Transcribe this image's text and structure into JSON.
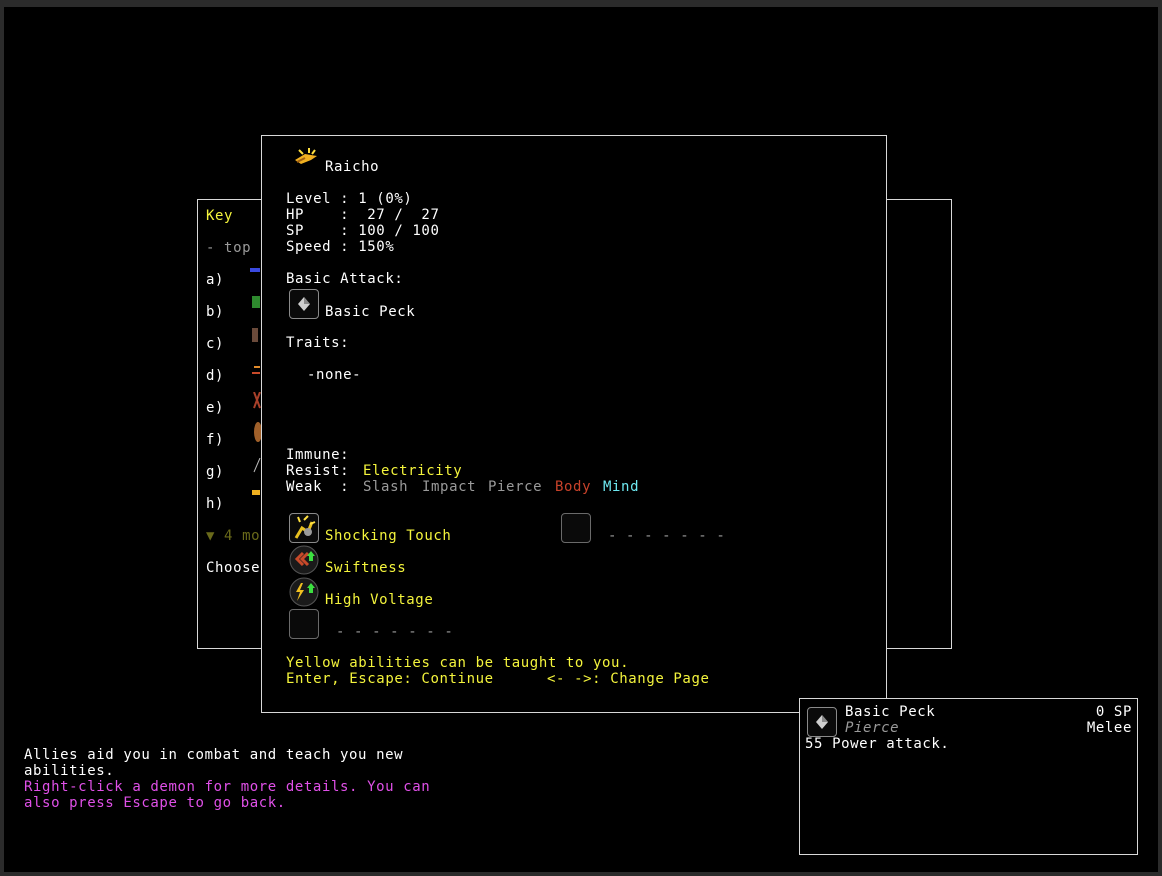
{
  "back_panel": {
    "title": "Key",
    "top_line": "- top",
    "rows": [
      "a)",
      "b)",
      "c)",
      "d)",
      "e)",
      "f)",
      "g)",
      "h)"
    ],
    "more_line": "▼ 4 mo",
    "choose_line": "Choose"
  },
  "demon": {
    "name": "Raicho",
    "stats": [
      "Level : 1 (0%)",
      "HP    :  27 /  27",
      "SP    : 100 / 100",
      "Speed : 150%"
    ],
    "basic_attack_label": "Basic Attack:",
    "basic_attack": "Basic Peck",
    "traits_label": "Traits:",
    "traits_value": "-none-",
    "immune_label": "Immune:",
    "resist_label": "Resist:",
    "resist_values": [
      "Electricity"
    ],
    "weak_label": "Weak  :",
    "weak_values": [
      "Slash",
      "Impact",
      "Pierce",
      "Body",
      "Mind"
    ],
    "abilities": [
      "Shocking Touch",
      "Swiftness",
      "High Voltage"
    ],
    "empty_slot": "- - - - - - -",
    "hint_yellow": "Yellow",
    "hint_rest": " abilities can be taught to you.",
    "controls_1": "Enter, Escape: Continue",
    "controls_2": "<- ->: Change Page"
  },
  "message_log": {
    "line1": "Allies aid you in combat and teach you new",
    "line2": "abilities.",
    "line3": "Right-click a demon for more details. You can",
    "line4": "also press Escape to go back."
  },
  "tooltip": {
    "name": "Basic Peck",
    "cost": "0 SP",
    "type": "Pierce",
    "range": "Melee",
    "description": "55 Power attack."
  },
  "colors": {
    "yellow": "#f4f43c",
    "red": "#c8422a",
    "cyan": "#6ee8f0",
    "magenta": "#e050e8",
    "gray": "#9a9a9a"
  }
}
